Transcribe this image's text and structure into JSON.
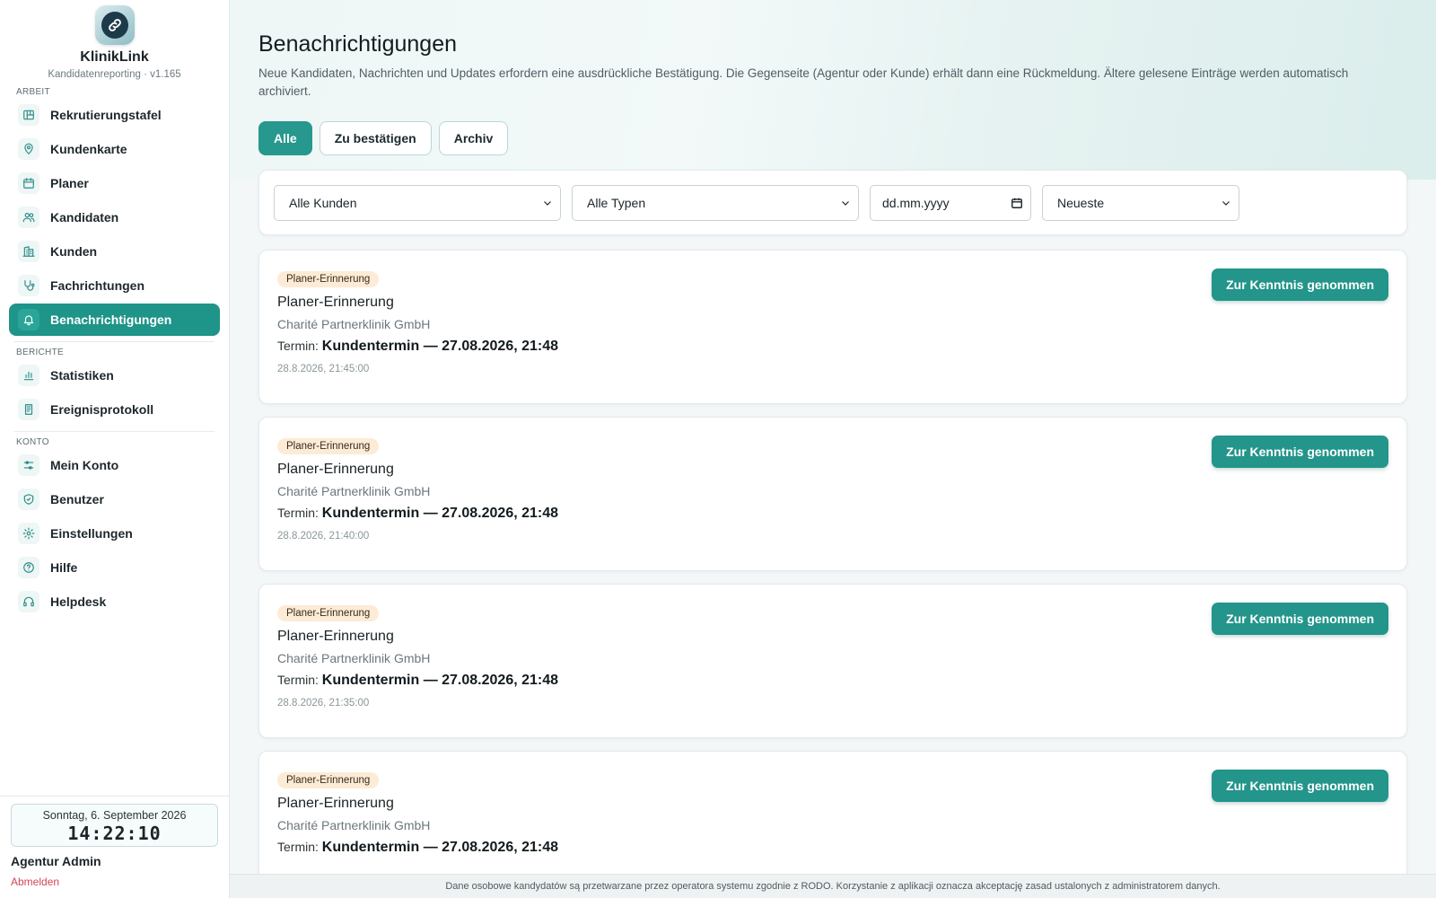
{
  "brand": {
    "name": "KlinikLink",
    "subtitle": "Kandidatenreporting · v1.165"
  },
  "sidebar": {
    "sections": [
      {
        "label": "ARBEIT",
        "items": [
          {
            "label": "Rekrutierungstafel",
            "icon": "board-icon"
          },
          {
            "label": "Kundenkarte",
            "icon": "map-pin-icon"
          },
          {
            "label": "Planer",
            "icon": "calendar-icon"
          },
          {
            "label": "Kandidaten",
            "icon": "users-icon"
          },
          {
            "label": "Kunden",
            "icon": "building-icon"
          },
          {
            "label": "Fachrichtungen",
            "icon": "stethoscope-icon"
          },
          {
            "label": "Benachrichtigungen",
            "icon": "bell-icon",
            "active": true
          }
        ]
      },
      {
        "label": "BERICHTE",
        "items": [
          {
            "label": "Statistiken",
            "icon": "bar-chart-icon"
          },
          {
            "label": "Ereignisprotokoll",
            "icon": "log-icon"
          }
        ]
      },
      {
        "label": "KONTO",
        "items": [
          {
            "label": "Mein Konto",
            "icon": "sliders-icon"
          },
          {
            "label": "Benutzer",
            "icon": "shield-icon"
          },
          {
            "label": "Einstellungen",
            "icon": "gear-icon"
          },
          {
            "label": "Hilfe",
            "icon": "help-icon"
          },
          {
            "label": "Helpdesk",
            "icon": "headset-icon"
          }
        ]
      }
    ],
    "clock": {
      "date": "Sonntag, 6. September 2026",
      "time": "14:22:10"
    },
    "user": "Agentur Admin",
    "logout": "Abmelden"
  },
  "header": {
    "title": "Benachrichtigungen",
    "description": "Neue Kandidaten, Nachrichten und Updates erfordern eine ausdrückliche Bestätigung. Die Gegenseite (Agentur oder Kunde) erhält dann eine Rückmeldung. Ältere gelesene Einträge werden automatisch archiviert."
  },
  "tabs": [
    {
      "label": "Alle",
      "active": true
    },
    {
      "label": "Zu bestätigen",
      "active": false
    },
    {
      "label": "Archiv",
      "active": false
    }
  ],
  "filters": {
    "client": "Alle Kunden",
    "type": "Alle Typen",
    "date_placeholder": "dd.mm.yyyy",
    "sort": "Neueste"
  },
  "notifications": [
    {
      "badge": "Planer-Erinnerung",
      "title": "Planer-Erinnerung",
      "client": "Charité Partnerklinik GmbH",
      "term_label": "Termin:",
      "term_value": "Kundentermin — 27.08.2026, 21:48",
      "timestamp": "28.8.2026, 21:45:00",
      "action": "Zur Kenntnis genommen"
    },
    {
      "badge": "Planer-Erinnerung",
      "title": "Planer-Erinnerung",
      "client": "Charité Partnerklinik GmbH",
      "term_label": "Termin:",
      "term_value": "Kundentermin — 27.08.2026, 21:48",
      "timestamp": "28.8.2026, 21:40:00",
      "action": "Zur Kenntnis genommen"
    },
    {
      "badge": "Planer-Erinnerung",
      "title": "Planer-Erinnerung",
      "client": "Charité Partnerklinik GmbH",
      "term_label": "Termin:",
      "term_value": "Kundentermin — 27.08.2026, 21:48",
      "timestamp": "28.8.2026, 21:35:00",
      "action": "Zur Kenntnis genommen"
    },
    {
      "badge": "Planer-Erinnerung",
      "title": "Planer-Erinnerung",
      "client": "Charité Partnerklinik GmbH",
      "term_label": "Termin:",
      "term_value": "Kundentermin — 27.08.2026, 21:48",
      "timestamp": "",
      "action": "Zur Kenntnis genommen"
    }
  ],
  "footer": "Dane osobowe kandydatów są przetwarzane przez operatora systemu zgodnie z RODO. Korzystanie z aplikacji oznacza akceptację zasad ustalonych z administratorem danych.",
  "colors": {
    "accent": "#23958a",
    "badge_bg": "#fcebd6",
    "logout": "#d3455a"
  }
}
